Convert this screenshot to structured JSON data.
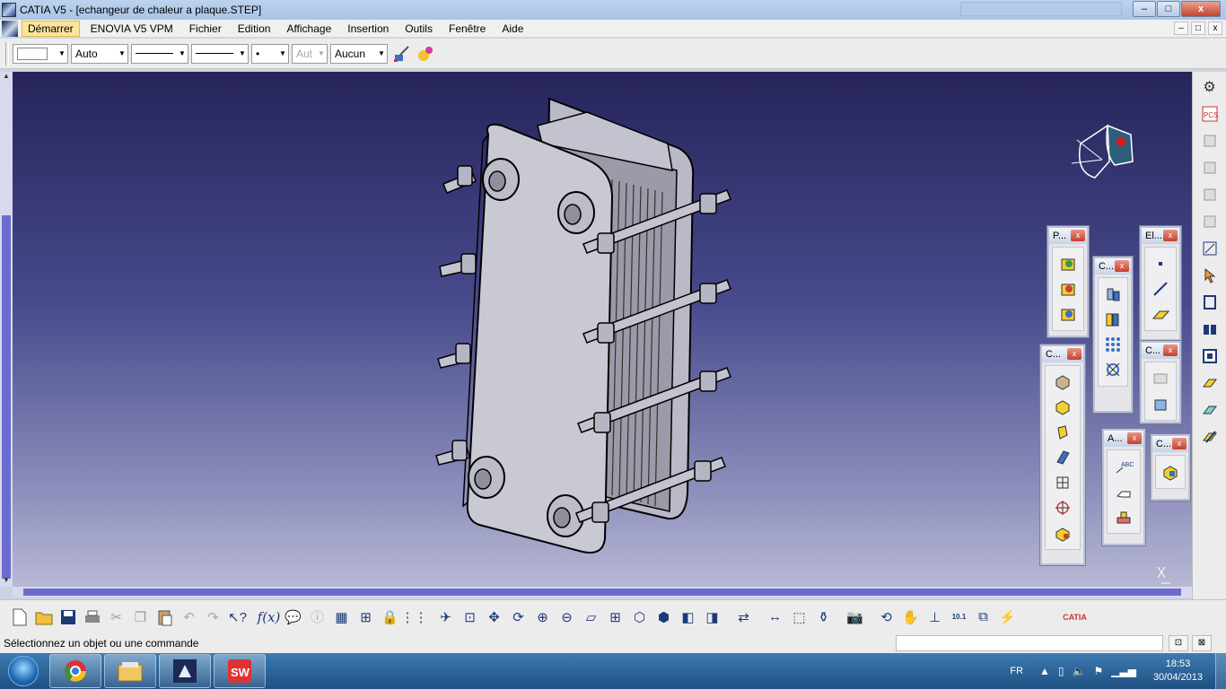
{
  "window": {
    "title": "CATIA V5 - [echangeur de chaleur a plaque.STEP]",
    "buttons": [
      "–",
      "□",
      "x"
    ]
  },
  "menu": {
    "items": [
      "Démarrer",
      "ENOVIA V5 VPM",
      "Fichier",
      "Edition",
      "Affichage",
      "Insertion",
      "Outils",
      "Fenêtre",
      "Aide"
    ],
    "mdi_buttons": [
      "–",
      "□",
      "x"
    ]
  },
  "graphic_props": {
    "fill_color": "",
    "transparency": "Auto",
    "line_thickness": "",
    "line_type": "",
    "point_symbol": "•",
    "layer_disabled": "Aut",
    "layer": "Aucun"
  },
  "palettes": {
    "p": "P...",
    "c1": "C...",
    "el": "El...",
    "c2": "C...",
    "c3": "C...",
    "a": "A...",
    "c4": "C..."
  },
  "status": {
    "message": "Sélectionnez un objet ou une commande"
  },
  "taskbar": {
    "lang": "FR",
    "time": "18:53",
    "date": "30/04/2013"
  },
  "colors": {
    "viewport_top": "#26245a",
    "viewport_bottom": "#b8b9d4",
    "part": "#c8c8d2",
    "scroll_thumb": "#6c6cd0"
  }
}
